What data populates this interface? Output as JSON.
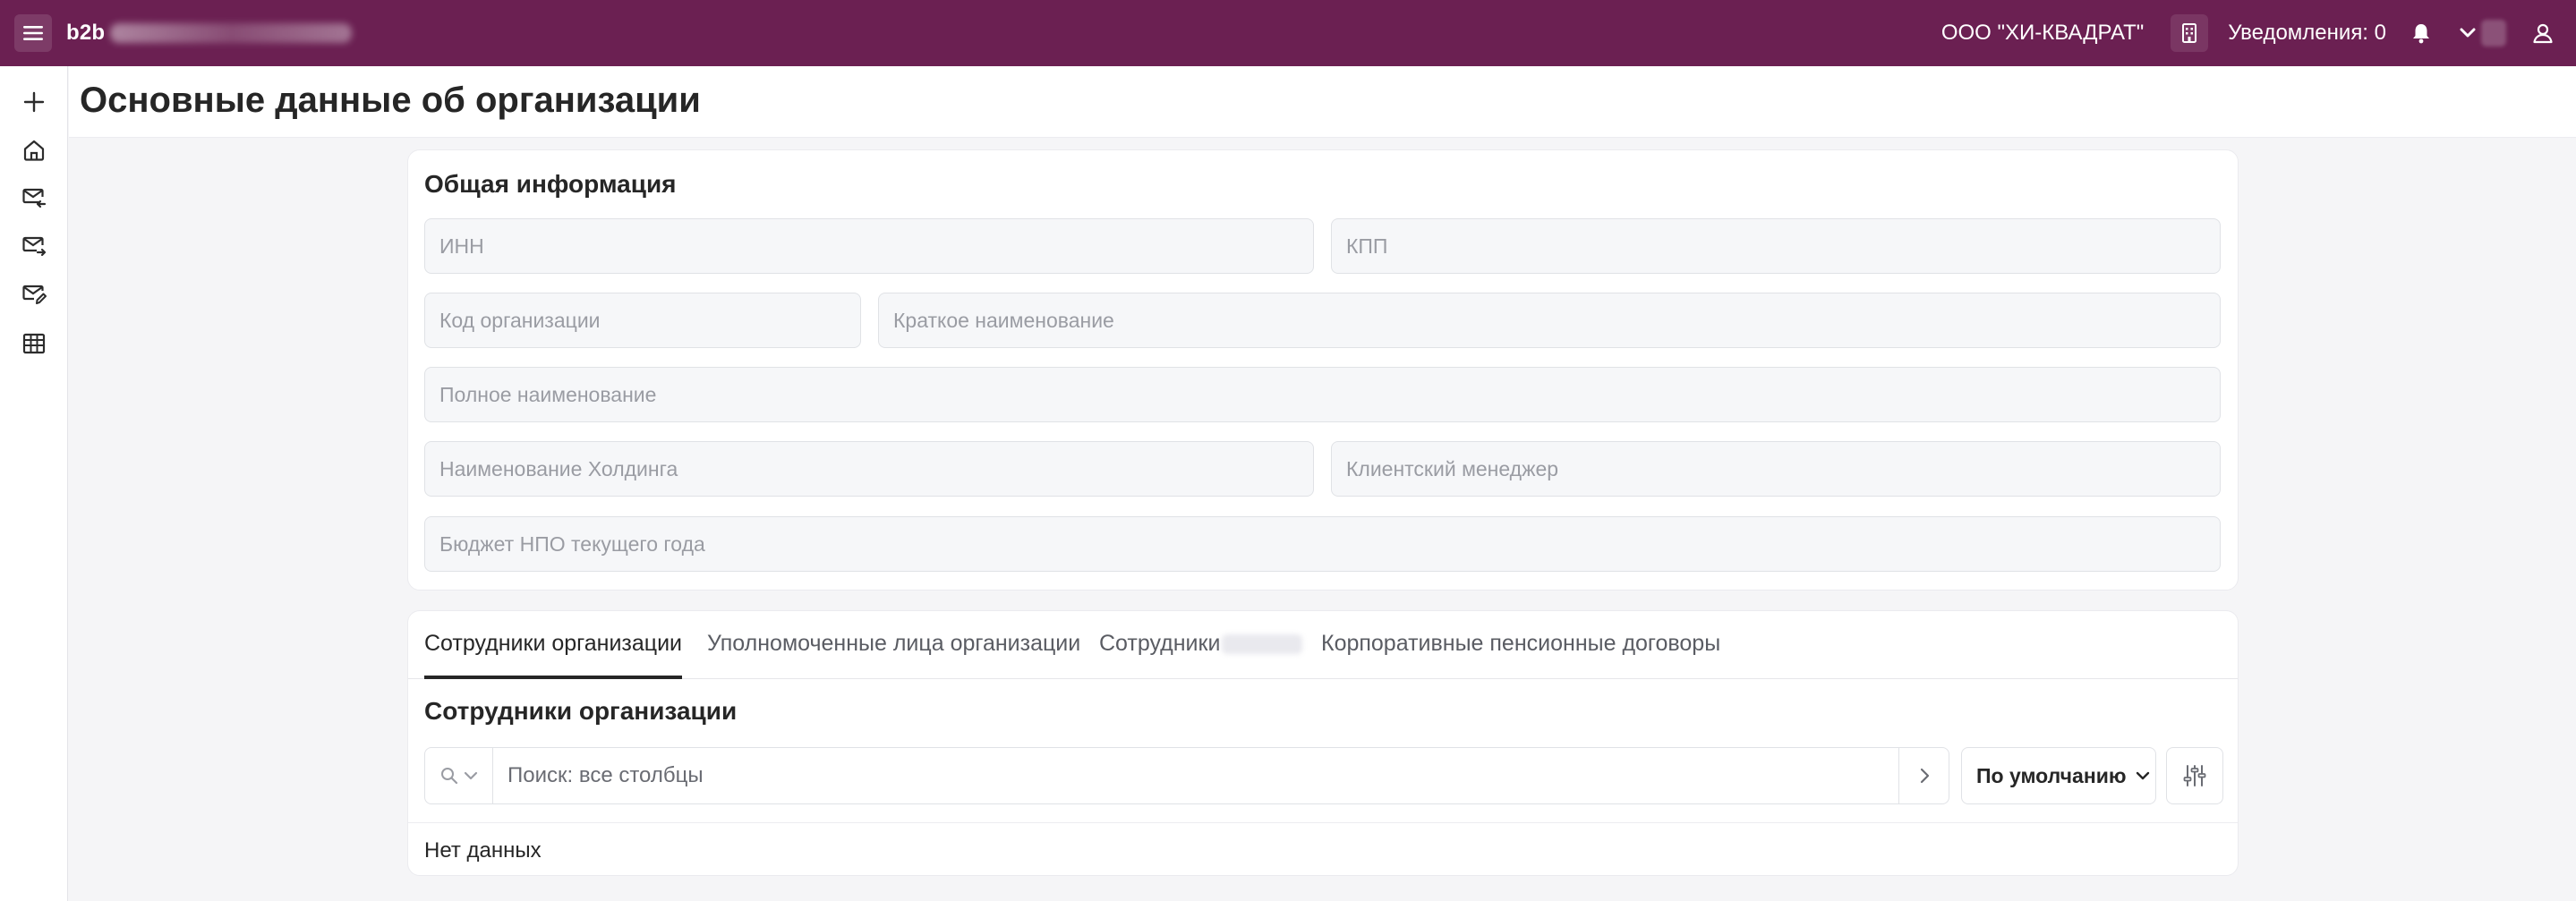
{
  "app": {
    "brand": "b2b",
    "org_name": "ООО \"ХИ-КВАДРАТ\"",
    "notifications_label": "Уведомления: 0",
    "accent_color": "#6b2052"
  },
  "rail": {
    "items": [
      {
        "icon": "plus-icon"
      },
      {
        "icon": "home-icon"
      },
      {
        "icon": "mail-incoming-icon"
      },
      {
        "icon": "mail-outgoing-icon"
      },
      {
        "icon": "mail-edit-icon"
      },
      {
        "icon": "table-icon"
      }
    ]
  },
  "page": {
    "title": "Основные данные об организации"
  },
  "general": {
    "title": "Общая информация",
    "fields": {
      "inn": "ИНН",
      "kpp": "КПП",
      "org_code": "Код организации",
      "short_name": "Краткое наименование",
      "full_name": "Полное наименование",
      "holding_name": "Наименование Холдинга",
      "client_manager": "Клиентский менеджер",
      "npo_budget": "Бюджет НПО текущего года"
    }
  },
  "tabs": {
    "items": [
      {
        "label": "Сотрудники организации",
        "active": true
      },
      {
        "label": "Уполномоченные лица организации",
        "active": false
      },
      {
        "label": "Сотрудники",
        "active": false
      },
      {
        "label": "Корпоративные пенсионные договоры",
        "active": false
      }
    ]
  },
  "employees": {
    "title": "Сотрудники организации",
    "search_placeholder": "Поиск: все столбцы",
    "sort_label": "По умолчанию",
    "empty_text": "Нет данных"
  }
}
